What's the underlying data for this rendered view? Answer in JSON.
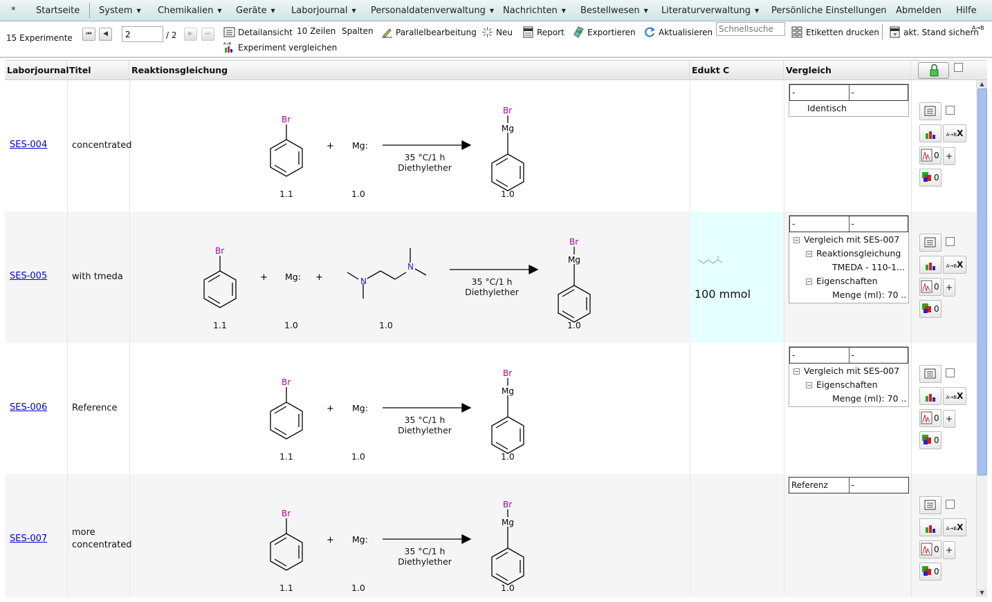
{
  "menu": {
    "star": "*",
    "items": [
      "Startseite",
      "System",
      "Chemikalien",
      "Geräte",
      "Laborjournal",
      "Personaldatenverwaltung",
      "Nachrichten",
      "Bestellwesen",
      "Literaturverwaltung",
      "Persönliche Einstellungen",
      "Abmelden",
      "Hilfe"
    ]
  },
  "toolbar": {
    "count": "15 Experimente",
    "page_value": "2",
    "page_total": "/ 2",
    "detail": "Detailansicht",
    "rows": "10 Zeilen",
    "columns": "Spalten",
    "parallel": "Parallelbearbeitung",
    "new": "Neu",
    "report": "Report",
    "export": "Exportieren",
    "refresh": "Aktualisieren",
    "search_placeholder": "Schnellsuche",
    "labels": "Etiketten drucken",
    "save": "akt. Stand sichern",
    "compare": "Experiment vergleichen"
  },
  "columns": {
    "journal": "Laborjournal",
    "title": "Titel",
    "reaction": "Reaktionsgleichung",
    "edukt": "Edukt C",
    "compare": "Vergleich"
  },
  "reaction_text": {
    "br": "Br",
    "mg": "Mg",
    "mg_reagent": "Mg:",
    "plus": "+",
    "n": "N",
    "temp": "35 °C/1 h",
    "solvent": "Diethylether"
  },
  "rows": [
    {
      "id": "SES-004",
      "title": "concentrated",
      "coef": [
        "1.1",
        "1.0",
        "1.0"
      ],
      "edukt": "",
      "cmp_head": [
        "-",
        "-"
      ],
      "tree": [
        "Identisch"
      ]
    },
    {
      "id": "SES-005",
      "title": "with tmeda",
      "coef": [
        "1.1",
        "1.0",
        "1.0",
        "1.0"
      ],
      "edukt": "100 mmol",
      "cmp_head": [
        "-",
        "-"
      ],
      "tree": [
        "Vergleich mit SES-007",
        "Reaktionsgleichung",
        "TMEDA - 110-1...",
        "Eigenschaften",
        "Menge (ml): 70 ..."
      ]
    },
    {
      "id": "SES-006",
      "title": "Reference",
      "coef": [
        "1.1",
        "1.0",
        "1.0"
      ],
      "edukt": "",
      "cmp_head": [
        "-",
        "-"
      ],
      "tree": [
        "Vergleich mit SES-007",
        "Eigenschaften",
        "Menge (ml): 70 ..."
      ]
    },
    {
      "id": "SES-007",
      "title": "more concentrated",
      "coef": [
        "1.1",
        "1.0",
        "1.0"
      ],
      "edukt": "",
      "cmp_head": [
        "Referenz",
        "-"
      ],
      "tree": []
    }
  ],
  "action_counts": {
    "spectra": "0",
    "chem": "0"
  },
  "icons": {
    "ab": "A→B",
    "x": "X",
    "plus": "+"
  }
}
